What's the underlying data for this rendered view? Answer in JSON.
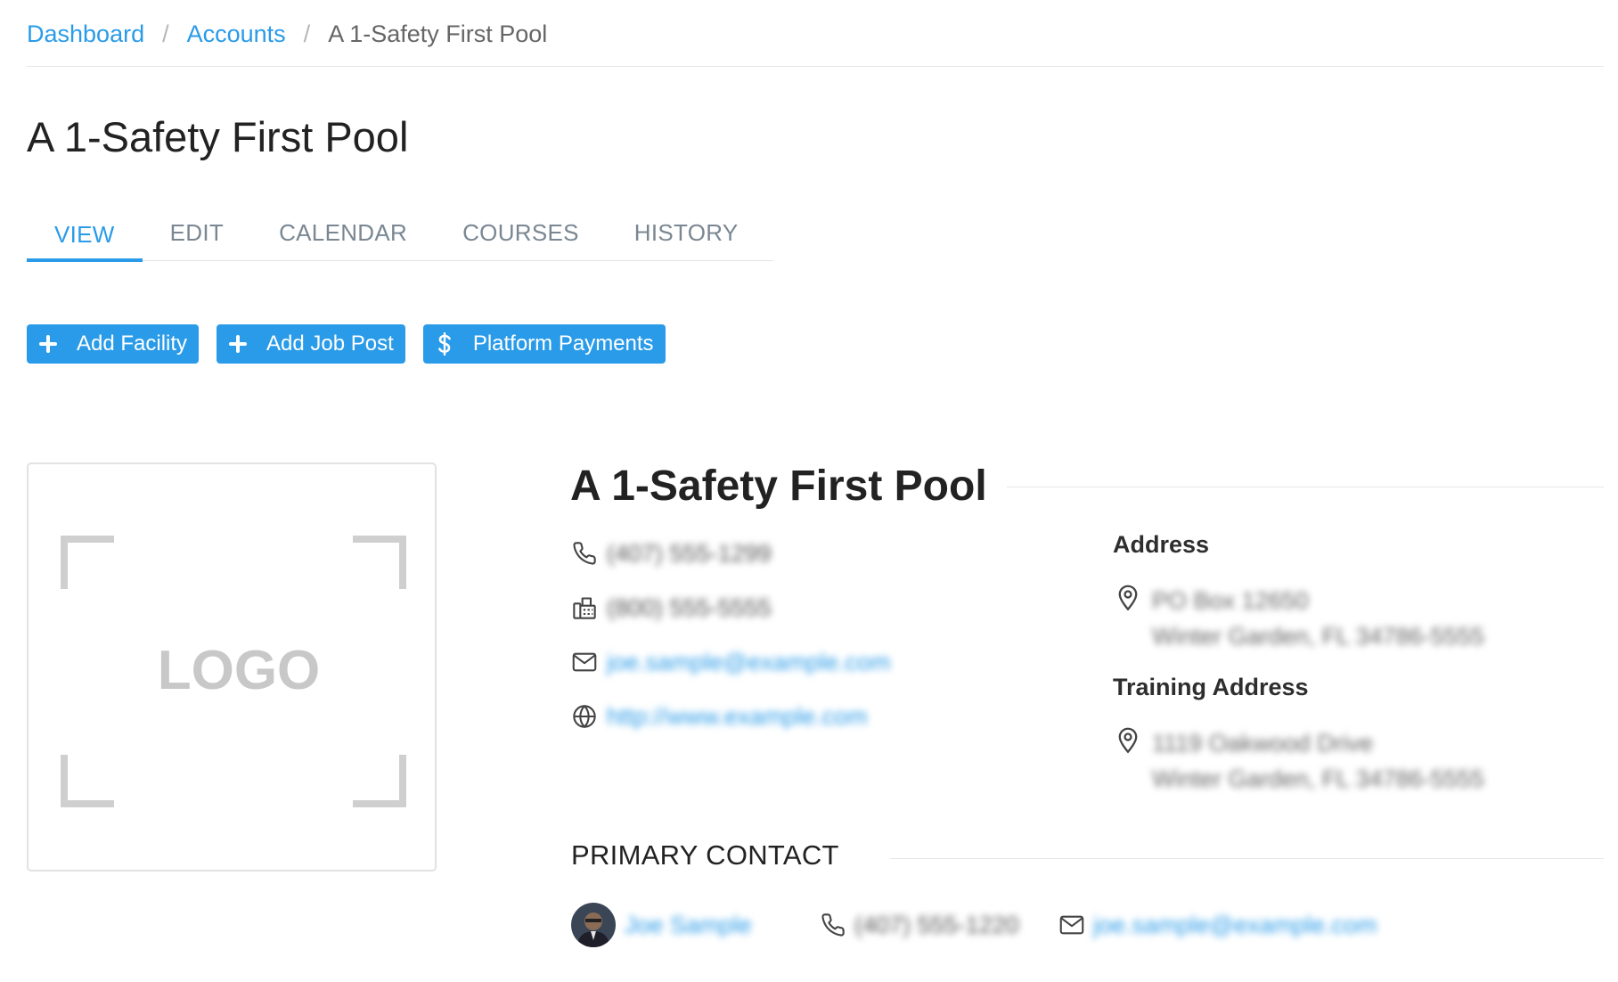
{
  "breadcrumb": {
    "items": [
      "Dashboard",
      "Accounts"
    ],
    "current": "A 1-Safety First Pool",
    "separator": "/"
  },
  "page_title": "A 1-Safety First Pool",
  "tabs": [
    {
      "label": "VIEW",
      "active": true
    },
    {
      "label": "EDIT",
      "active": false
    },
    {
      "label": "CALENDAR",
      "active": false
    },
    {
      "label": "COURSES",
      "active": false
    },
    {
      "label": "HISTORY",
      "active": false
    }
  ],
  "actions": {
    "add_facility": {
      "label": "Add Facility",
      "icon": "plus-icon"
    },
    "add_job_post": {
      "label": "Add Job Post",
      "icon": "plus-icon"
    },
    "platform_payments": {
      "label": "Platform Payments",
      "icon": "dollar-icon"
    }
  },
  "logo_placeholder": {
    "text": "LOGO"
  },
  "account": {
    "name": "A 1-Safety First Pool",
    "phone": "(407) 555-1299",
    "fax": "(800) 555-5555",
    "email": "joe.sample@example.com",
    "website": "http://www.example.com",
    "address_heading": "Address",
    "address_line1": "PO Box 12650",
    "address_line2": "Winter Garden, FL 34786-5555",
    "training_address_heading": "Training Address",
    "training_address_line1": "1119 Oakwood Drive",
    "training_address_line2": "Winter Garden, FL 34786-5555"
  },
  "primary_contact": {
    "heading": "PRIMARY CONTACT",
    "name": "Joe Sample",
    "phone": "(407) 555-1220",
    "email": "joe.sample@example.com"
  },
  "colors": {
    "accent": "#2a9be8",
    "text": "#333333",
    "muted": "#7a8792",
    "border": "#e6e6e6"
  }
}
